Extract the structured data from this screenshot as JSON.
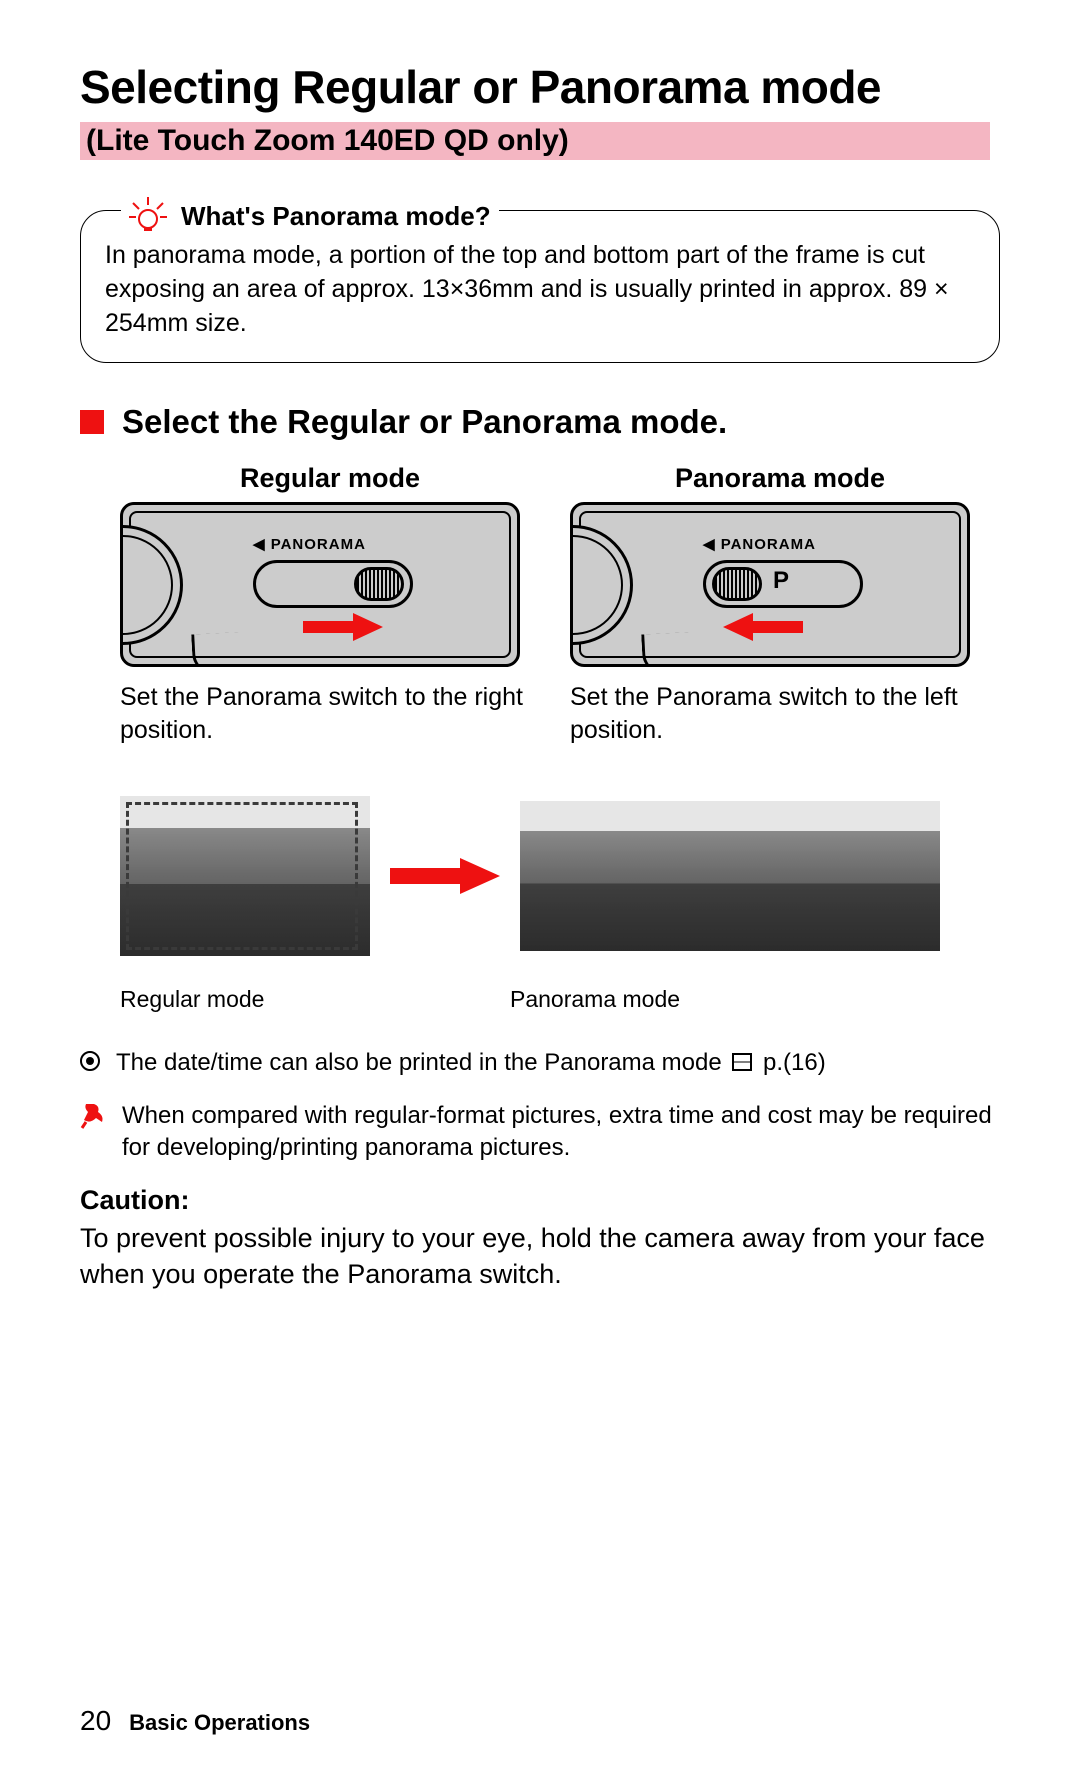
{
  "title": "Selecting Regular or Panorama mode",
  "subtitle": "(Lite Touch Zoom 140ED QD only)",
  "tip": {
    "heading": "What's Panorama mode?",
    "body": "In panorama mode, a portion of the top and bottom part of the frame is cut exposing an area of approx. 13×36mm and is usually printed in approx. 89 × 254mm size."
  },
  "section": {
    "heading": "Select the Regular or Panorama mode."
  },
  "modes": {
    "regular": {
      "heading": "Regular mode",
      "switch_label": "◀ PANORAMA",
      "caption": "Set the Panorama switch to the right position.",
      "photo_label": "Regular mode"
    },
    "panorama": {
      "heading": "Panorama mode",
      "switch_label": "◀ PANORAMA",
      "p_mark": "P",
      "caption": "Set the Panorama switch to the left position.",
      "photo_label": "Panorama mode"
    }
  },
  "notes": {
    "date_note_pre": "The date/time can also be printed in the Panorama mode ",
    "date_note_post": " p.(16)",
    "cost_note": "When compared with regular-format pictures, extra time and cost may be required for developing/printing panorama pictures."
  },
  "caution": {
    "heading": "Caution:",
    "body": "To prevent possible injury to your eye, hold the camera away from your face when you operate the Panorama switch."
  },
  "footer": {
    "page": "20",
    "chapter": "Basic Operations"
  }
}
